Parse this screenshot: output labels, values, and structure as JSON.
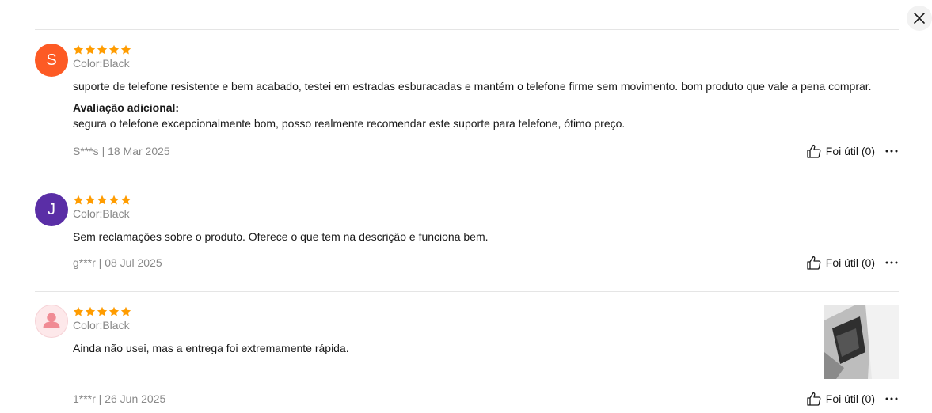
{
  "modal": {
    "close_icon": "close-icon"
  },
  "colors": {
    "star": "#ff9c00",
    "meta": "#888888",
    "divider": "#e5e5e5"
  },
  "reviews": [
    {
      "avatar_letter": "S",
      "avatar_color": "#fd5a24",
      "rating": 5,
      "sku": "Color:Black",
      "text": "suporte de telefone resistente e bem acabado, testei em estradas esburacadas e mantém o telefone firme sem movimento. bom produto que vale a pena comprar.",
      "additional_label": "Avaliação adicional:",
      "additional_text": "segura o telefone excepcionalmente bom, posso realmente recomendar este suporte para telefone, ótimo preço.",
      "meta": "S***s | 18 Mar 2025",
      "helpful": "Foi útil (0)"
    },
    {
      "avatar_letter": "J",
      "avatar_color": "#5a2ea6",
      "rating": 5,
      "sku": "Color:Black",
      "text": "Sem reclamações sobre o produto. Oferece o que tem na descrição e funciona bem.",
      "meta": "g***r | 08 Jul 2025",
      "helpful": "Foi útil (0)"
    },
    {
      "avatar_icon": "default-user-avatar",
      "rating": 5,
      "sku": "Color:Black",
      "text": "Ainda não usei, mas a entrega foi extremamente rápida.",
      "meta": "1***r | 26 Jun 2025",
      "helpful": "Foi útil (0)",
      "has_photo": true
    }
  ]
}
